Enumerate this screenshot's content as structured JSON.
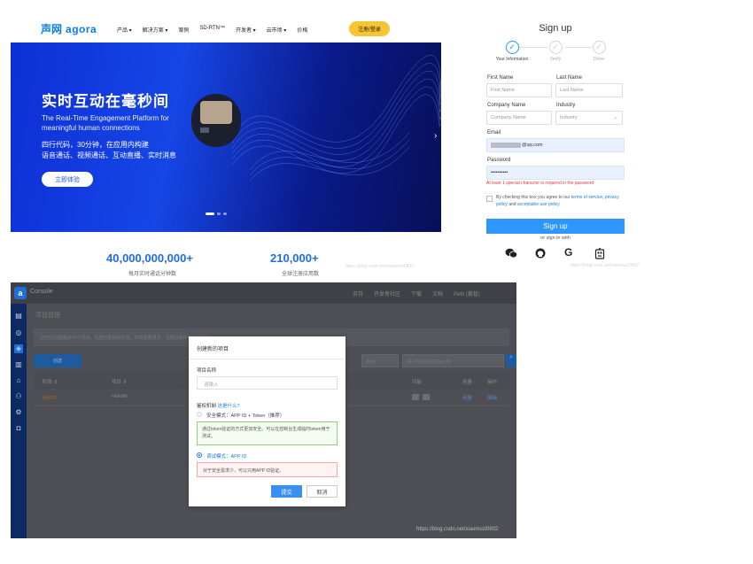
{
  "website": {
    "logo_cn": "声网",
    "logo_en": "agora",
    "nav": [
      "产品 ▾",
      "解决方案 ▾",
      "案例",
      "SD-RTN™",
      "开发者 ▾",
      "云市场 ▾",
      "价格"
    ],
    "signup_button": "注册/登录",
    "hero_title": "实时互动在毫秒间",
    "hero_subtitle": "The Real-Time Engagement Platform for meaningful human connections",
    "hero_cn_line1": "四行代码，30分钟，在应用内构建",
    "hero_cn_line2": "语音通话、视频通话、互动直播、实时消息",
    "try_button": "立即体验",
    "stat1_value": "40,000,000,000+",
    "stat1_label": "每月实时通话分钟数",
    "stat2_value": "210,000+",
    "stat2_label": "全球注册应用数"
  },
  "signup": {
    "title": "Sign up",
    "steps": [
      "Your Information",
      "Verify",
      "Done"
    ],
    "first_name_label": "First Name",
    "first_name_placeholder": "First Name",
    "last_name_label": "Last Name",
    "last_name_placeholder": "Last Name",
    "company_label": "Company Name",
    "company_placeholder": "Company Name",
    "industry_label": "Industry",
    "industry_placeholder": "Industry",
    "email_label": "Email",
    "email_value": "@qq.com",
    "password_label": "Password",
    "password_value": "••••••••••",
    "password_error": "At least 1 special character is required in the password",
    "agree_prefix": "By checking this box you agree to our",
    "agree_terms": "terms of service",
    "agree_and": "and",
    "agree_privacy": "privacy policy",
    "agree_use": "acceptable use policy",
    "submit": "Sign up",
    "or_sign_in": "or sign in with"
  },
  "console": {
    "title": "Console",
    "top_links": [
      "支持",
      "开发者社区",
      "下载",
      "文档",
      "Petit (黄智)"
    ],
    "page_title": "项目管理",
    "info_text": "您可以创建最多10个项目，包括已删除的项目，如果需要更多，请通过邮件与我们联系。",
    "create_button": "创建",
    "filter_label": "启用",
    "search_placeholder": "输入项目名称或App ID",
    "columns": [
      "阶段 ⇕",
      "项目 ⇕",
      "功能",
      "用量",
      "操作"
    ],
    "row": {
      "stage": "测试中",
      "project": "HelloW",
      "usage": "用量",
      "action": "编辑"
    },
    "watermark": "https://blog.csdn.net/xiaomuzi0802"
  },
  "modal": {
    "title": "创建新的项目",
    "name_label": "项目名称",
    "name_placeholder": "请输入",
    "auth_label": "鉴权机制",
    "auth_help": "这是什么?",
    "option1": "安全模式：APP ID + Token（推荐）",
    "option1_desc": "通过token验证的方式更加安全。可以在控制台生成临时token用于测试。",
    "option2": "调试模式：APP ID",
    "option2_desc": "对于安全需求少，可以只用APP ID验证。",
    "submit": "提交",
    "cancel": "取消"
  },
  "watermarks": [
    "https://blog.csdn.net/xiaomuzi0802",
    "https://blog.csdn.net/xiaomuzi0802"
  ]
}
